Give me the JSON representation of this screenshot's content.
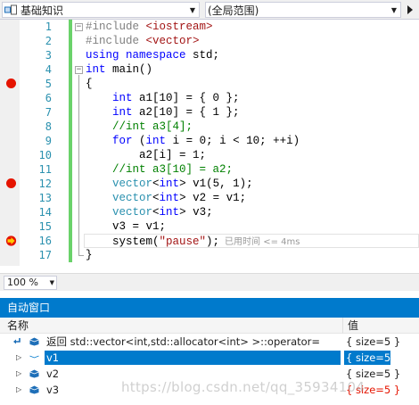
{
  "navbar": {
    "project_combo": "基础知识",
    "scope_combo": "(全局范围)"
  },
  "editor": {
    "lines": [
      {
        "n": "1",
        "html": "<span class='pp'>#include</span> <span class='str'>&lt;iostream&gt;</span>"
      },
      {
        "n": "2",
        "html": "<span class='pp'>#include</span> <span class='str'>&lt;vector&gt;</span>"
      },
      {
        "n": "3",
        "html": "<span class='kw'>using</span> <span class='kw'>namespace</span> std;"
      },
      {
        "n": "4",
        "html": "<span class='kw'>int</span> main()"
      },
      {
        "n": "5",
        "html": "{"
      },
      {
        "n": "6",
        "html": "    <span class='kw'>int</span> a1[10] = { 0 };"
      },
      {
        "n": "7",
        "html": "    <span class='kw'>int</span> a2[10] = { 1 };"
      },
      {
        "n": "8",
        "html": "    <span class='cmt'>//int a3[4];</span>"
      },
      {
        "n": "9",
        "html": "    <span class='kw'>for</span> (<span class='kw'>int</span> i = 0; i &lt; 10; ++i)"
      },
      {
        "n": "10",
        "html": "        a2[i] = 1;"
      },
      {
        "n": "11",
        "html": "    <span class='cmt'>//int a3[10] = a2;</span>"
      },
      {
        "n": "12",
        "html": "    <span class='ty'>vector</span>&lt;<span class='kw'>int</span>&gt; v1(5, 1);"
      },
      {
        "n": "13",
        "html": "    <span class='ty'>vector</span>&lt;<span class='kw'>int</span>&gt; v2 = v1;"
      },
      {
        "n": "14",
        "html": "    <span class='ty'>vector</span>&lt;<span class='kw'>int</span>&gt; v3;"
      },
      {
        "n": "15",
        "html": "    v3 = v1;"
      },
      {
        "n": "16",
        "html": "    system(<span class='str'>\"pause\"</span>);"
      },
      {
        "n": "17",
        "html": "}"
      }
    ],
    "elapsed_label": "已用时间 <= 4ms"
  },
  "zoom": {
    "value": "100 %"
  },
  "autos": {
    "title": "自动窗口",
    "col_name": "名称",
    "col_value": "值",
    "rows": [
      {
        "name": "返回 std::vector<int,std::allocator<int> >::operator=",
        "value": "{ size=5 }"
      },
      {
        "name": "v1",
        "value": "{ size=5 }"
      },
      {
        "name": "v2",
        "value": "{ size=5 }"
      },
      {
        "name": "v3",
        "value": "{ size=5 }"
      }
    ]
  },
  "watermark": "https://blog.csdn.net/qq_35934104",
  "colors": {
    "accent": "#007acc",
    "breakpoint": "#e51400",
    "change_bar": "#6ad26a",
    "keyword": "#0000ff",
    "string": "#a31515",
    "comment": "#008000",
    "changed_value": "#e51400"
  }
}
